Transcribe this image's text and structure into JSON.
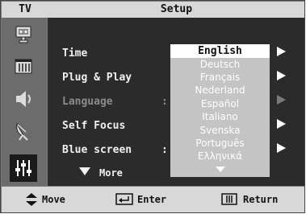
{
  "header": {
    "tv_label": "TV",
    "title": "Setup"
  },
  "sidebar": {
    "icons": [
      "picture-icon",
      "channel-icon",
      "sound-icon",
      "antenna-icon",
      "setup-equalizer-icon"
    ]
  },
  "menu": {
    "items": [
      {
        "label": "Time",
        "colon": "",
        "disabled": false
      },
      {
        "label": "Plug & Play",
        "colon": "",
        "disabled": false
      },
      {
        "label": "Language",
        "colon": ":",
        "disabled": true
      },
      {
        "label": "Self Focus",
        "colon": "",
        "disabled": false
      },
      {
        "label": "Blue screen",
        "colon": ":",
        "disabled": false
      }
    ],
    "more_label": "More"
  },
  "language_dropdown": {
    "selected": "English",
    "options": [
      "English",
      "Deutsch",
      "Français",
      "Nederland",
      "Español",
      "Italiano",
      "Svenska",
      "Português",
      "Ελληνικά"
    ],
    "scroll_down_indicator": "triangle-down"
  },
  "footer": {
    "move_label": "Move",
    "enter_label": "Enter",
    "return_label": "Return"
  },
  "colors": {
    "osd_background": "#2b2b2b",
    "header_bar": "#d8d8d8",
    "sidebar": "#6c6c6c",
    "dropdown": "#c4c4c4",
    "highlight": "#ffffff",
    "disabled_text": "#8a8a8a"
  }
}
